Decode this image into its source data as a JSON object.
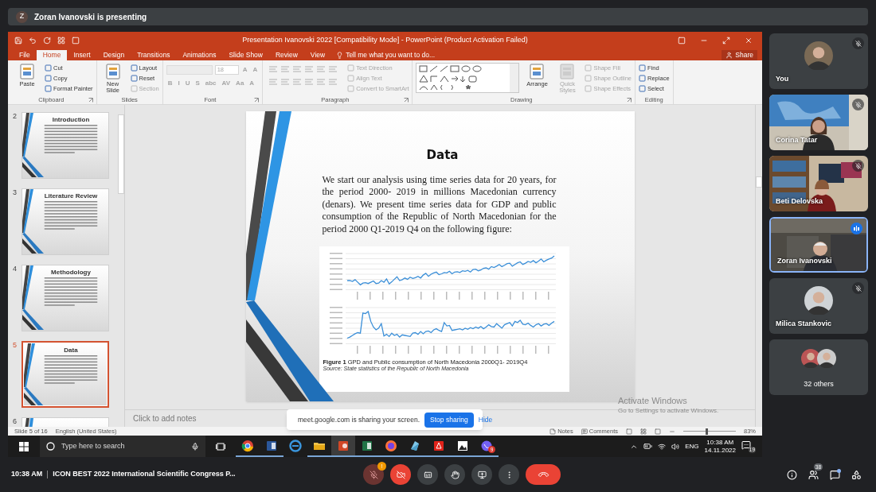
{
  "presenter_bar": {
    "initial": "Z",
    "text": "Zoran Ivanovski is presenting"
  },
  "powerpoint": {
    "title": "Presentation Ivanovski 2022 [Compatibility Mode] - PowerPoint (Product Activation Failed)",
    "tabs": [
      {
        "label": "File",
        "selected": false
      },
      {
        "label": "Home",
        "selected": true
      },
      {
        "label": "Insert",
        "selected": false
      },
      {
        "label": "Design",
        "selected": false
      },
      {
        "label": "Transitions",
        "selected": false
      },
      {
        "label": "Animations",
        "selected": false
      },
      {
        "label": "Slide Show",
        "selected": false
      },
      {
        "label": "Review",
        "selected": false
      },
      {
        "label": "View",
        "selected": false
      }
    ],
    "tell_me": "Tell me what you want to do...",
    "share": "Share",
    "ribbon": [
      {
        "name": "Clipboard",
        "launcher": true,
        "columns": [
          [
            {
              "kind": "large",
              "label": "Paste",
              "disabled": false
            }
          ],
          [
            {
              "kind": "small",
              "label": "Cut",
              "disabled": false
            },
            {
              "kind": "small",
              "label": "Copy",
              "disabled": false
            },
            {
              "kind": "small",
              "label": "Format Painter",
              "disabled": false
            }
          ]
        ]
      },
      {
        "name": "Slides",
        "launcher": false,
        "columns": [
          [
            {
              "kind": "large",
              "label": "New Slide",
              "disabled": false
            }
          ],
          [
            {
              "kind": "small",
              "label": "Layout",
              "disabled": false
            },
            {
              "kind": "small",
              "label": "Reset",
              "disabled": false
            },
            {
              "kind": "small",
              "label": "Section",
              "disabled": true
            }
          ]
        ]
      },
      {
        "name": "Font",
        "launcher": true,
        "columns": [
          [
            {
              "kind": "row",
              "items": [
                {
                  "kind": "font_field",
                  "disabled": true
                },
                {
                  "kind": "size_field",
                  "value": "18",
                  "disabled": true
                },
                {
                  "kind": "glyph",
                  "label": "A",
                  "disabled": true
                },
                {
                  "kind": "glyph",
                  "label": "A",
                  "disabled": true
                }
              ]
            },
            {
              "kind": "row",
              "items": [
                {
                  "kind": "glyph",
                  "label": "B",
                  "disabled": true
                },
                {
                  "kind": "glyph",
                  "label": "I",
                  "disabled": true
                },
                {
                  "kind": "glyph",
                  "label": "U",
                  "disabled": true
                },
                {
                  "kind": "glyph",
                  "label": "S",
                  "disabled": true
                },
                {
                  "kind": "glyph",
                  "label": "abc",
                  "disabled": true
                },
                {
                  "kind": "glyph",
                  "label": "AV",
                  "disabled": true
                },
                {
                  "kind": "glyph",
                  "label": "Aa",
                  "disabled": true
                },
                {
                  "kind": "glyph",
                  "label": "A",
                  "disabled": true
                }
              ]
            }
          ]
        ]
      },
      {
        "name": "Paragraph",
        "launcher": true,
        "columns": [
          [
            {
              "kind": "list_tools",
              "disabled": true
            }
          ],
          [
            {
              "kind": "small",
              "label": "Text Direction",
              "disabled": true
            },
            {
              "kind": "small",
              "label": "Align Text",
              "disabled": true
            },
            {
              "kind": "small",
              "label": "Convert to SmartArt",
              "disabled": true
            }
          ]
        ]
      },
      {
        "name": "Drawing",
        "launcher": true,
        "columns": [
          [
            {
              "kind": "gallery",
              "disabled": false
            }
          ],
          [
            {
              "kind": "large",
              "label": "Arrange",
              "disabled": false
            }
          ],
          [
            {
              "kind": "large",
              "label": "Quick Styles",
              "disabled": true
            }
          ],
          [
            {
              "kind": "small",
              "label": "Shape Fill",
              "disabled": true
            },
            {
              "kind": "small",
              "label": "Shape Outline",
              "disabled": true
            },
            {
              "kind": "small",
              "label": "Shape Effects",
              "disabled": true
            }
          ]
        ]
      },
      {
        "name": "Editing",
        "launcher": false,
        "columns": [
          [
            {
              "kind": "small",
              "label": "Find",
              "disabled": false
            },
            {
              "kind": "small",
              "label": "Replace",
              "disabled": false
            },
            {
              "kind": "small",
              "label": "Select",
              "disabled": false
            }
          ]
        ]
      }
    ],
    "thumbnails": [
      {
        "number": "2",
        "title": "Introduction",
        "selected": false
      },
      {
        "number": "3",
        "title": "Literature Review",
        "selected": false
      },
      {
        "number": "4",
        "title": "Methodology",
        "selected": false
      },
      {
        "number": "5",
        "title": "Data",
        "selected": true
      },
      {
        "number": "6",
        "selected": false
      }
    ],
    "slide": {
      "title": "Data",
      "body": "We start our analysis using time series data for 20 years, for the period 2000- 2019 in millions Macedonian currency (denars). We present time series data for GDP and public consumption of the Republic of North Macedonian for the period 2000 Q1-2019 Q4 on the following figure:",
      "caption": "**Figure 1** GPD and Public consumption of North Macedonia 2000Q1- 2019Q4",
      "source": "Source: State statistics of the Republic of North Macedonia"
    },
    "notes_placeholder": "Click to add notes",
    "status": {
      "slide": "Slide 5 of 16",
      "language": "English (United States)",
      "notes": "Notes",
      "comments": "Comments",
      "zoom": "83%",
      "level": 0.42
    }
  },
  "activation": {
    "title": "Activate Windows",
    "subtitle": "Go to Settings to activate Windows."
  },
  "share_notice": {
    "text": "meet.google.com is sharing your screen.",
    "stop": "Stop sharing",
    "hide": "Hide"
  },
  "taskbar": {
    "search": "Type here to search",
    "apps": [
      {
        "kind": "browser",
        "selected": false,
        "running": true
      },
      {
        "kind": "word",
        "selected": false,
        "running": true
      },
      {
        "kind": "edge",
        "selected": false,
        "running": false
      },
      {
        "kind": "folder",
        "selected": false,
        "running": true
      },
      {
        "kind": "powerpoint",
        "selected": true,
        "running": true
      },
      {
        "kind": "excel",
        "selected": false,
        "running": true
      },
      {
        "kind": "firefox",
        "selected": false,
        "running": true
      },
      {
        "kind": "app",
        "selected": false,
        "running": true
      },
      {
        "kind": "pdf",
        "selected": false,
        "running": true
      },
      {
        "kind": "photos",
        "selected": false,
        "running": true
      },
      {
        "kind": "chat",
        "selected": false,
        "running": true,
        "badge": "9"
      }
    ],
    "language": "ENG",
    "time": "10:38 AM",
    "date": "14.11.2022",
    "notifications": "19"
  },
  "participants": [
    {
      "name": "You",
      "kind": "avatar",
      "muted": true,
      "speaking": false
    },
    {
      "name": "Corina Tatar",
      "kind": "video",
      "muted": true,
      "speaking": false
    },
    {
      "name": "Beti Delovska",
      "kind": "video",
      "muted": true,
      "speaking": false
    },
    {
      "name": "Zoran Ivanovski",
      "kind": "video",
      "muted": false,
      "speaking": true
    },
    {
      "name": "Milica Stankovic",
      "kind": "avatar",
      "muted": true,
      "speaking": false
    },
    {
      "name": "32 others",
      "kind": "others",
      "muted": false,
      "speaking": false
    }
  ],
  "meeting_bar": {
    "time": "10:38 AM",
    "title": "ICON BEST 2022 International Scientific Congress P...",
    "mic_badge": "!",
    "people_count": "38",
    "chat_unread": true
  }
}
